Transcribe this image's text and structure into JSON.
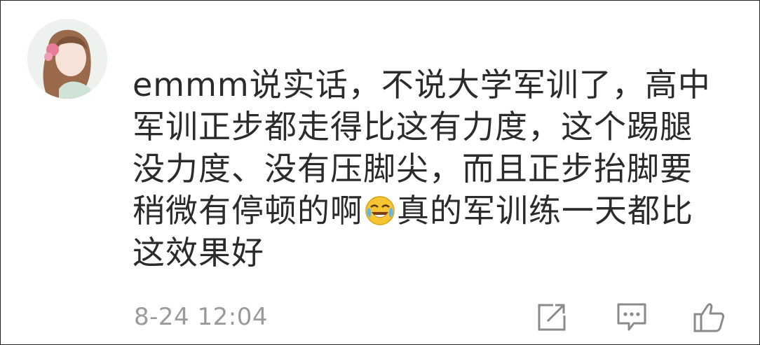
{
  "avatar": {
    "icon": "user-avatar-illustration"
  },
  "comment": {
    "lines": [
      "emmm说实话，不说大学军训了，高中",
      "军训正步都走得比这有力度，这个踢腿",
      "没力度、没有压脚尖，而且正步抬脚要",
      [
        "稍微有停顿的啊",
        "真的军训练一天都比"
      ],
      "这效果好"
    ],
    "emoji": "laughing-crying-emoji"
  },
  "timestamp": "8-24 12:04",
  "actions": {
    "share_icon": "share-icon",
    "reply_icon": "comment-icon",
    "like_icon": "thumbs-up-icon"
  },
  "colors": {
    "text": "#2b2b2b",
    "meta": "#9a9a9a",
    "icon": "#8a8a8a"
  }
}
